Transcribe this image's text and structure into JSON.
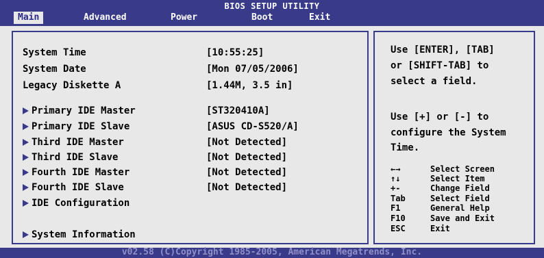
{
  "header": {
    "title": "BIOS SETUP UTILITY",
    "tabs": [
      "Main",
      "Advanced",
      "Power",
      "Boot",
      "Exit"
    ],
    "active_tab": "Main"
  },
  "main": {
    "fields": [
      {
        "label": "System Time",
        "value": "[10:55:25]"
      },
      {
        "label": "System Date",
        "value": "[Mon 07/05/2006]"
      },
      {
        "label": "Legacy Diskette A",
        "value": "[1.44M, 3.5 in]"
      }
    ],
    "submenus": [
      {
        "label": "Primary IDE Master",
        "value": "[ST320410A]"
      },
      {
        "label": "Primary IDE Slave",
        "value": "[ASUS CD-S520/A]"
      },
      {
        "label": "Third IDE Master",
        "value": "[Not Detected]"
      },
      {
        "label": "Third IDE Slave",
        "value": "[Not Detected]"
      },
      {
        "label": "Fourth IDE Master",
        "value": "[Not Detected]"
      },
      {
        "label": "Fourth IDE Slave",
        "value": "[Not Detected]"
      },
      {
        "label": "IDE Configuration",
        "value": ""
      },
      {
        "label": "System Information",
        "value": ""
      }
    ]
  },
  "help": {
    "line1": "Use [ENTER], [TAB]",
    "line2": "or [SHIFT-TAB] to",
    "line3": "select a field.",
    "line4": "Use [+] or [-] to",
    "line5": "configure the System",
    "line6": "Time."
  },
  "keys": [
    {
      "key": "←→",
      "desc": "Select Screen"
    },
    {
      "key": "↑↓",
      "desc": "Select Item"
    },
    {
      "key": "+-",
      "desc": "Change Field"
    },
    {
      "key": "Tab",
      "desc": "Select Field"
    },
    {
      "key": "F1",
      "desc": "General Help"
    },
    {
      "key": "F10",
      "desc": "Save and Exit"
    },
    {
      "key": "ESC",
      "desc": "Exit"
    }
  ],
  "footer": {
    "copyright": "v02.58 (C)Copyright 1985-2005, American Megatrends, Inc."
  },
  "colors": {
    "bios_blue": "#3a3a8a",
    "panel_bg": "#e8e8e8",
    "text": "#000000",
    "footer_text": "#9090c8"
  }
}
